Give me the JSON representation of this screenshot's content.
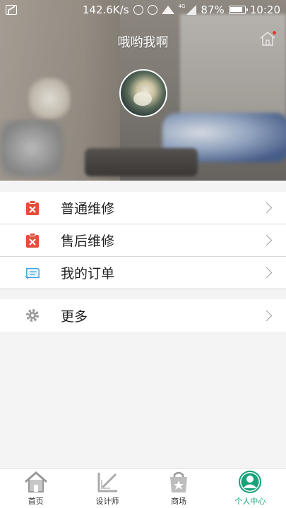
{
  "status_bar": {
    "speed": "142.6K/s",
    "network": "4G",
    "battery": "87%",
    "time": "10:20"
  },
  "header": {
    "title": "哦哟我啊"
  },
  "menu": {
    "items": [
      {
        "label": "普通维修",
        "icon": "repair-clipboard-icon"
      },
      {
        "label": "售后维修",
        "icon": "repair-clipboard-icon"
      },
      {
        "label": "我的订单",
        "icon": "order-scroll-icon"
      }
    ],
    "more": {
      "label": "更多",
      "icon": "gear-icon"
    }
  },
  "tabbar": {
    "tabs": [
      {
        "label": "首页",
        "icon": "home-icon",
        "active": false
      },
      {
        "label": "设计师",
        "icon": "ruler-pencil-icon",
        "active": false
      },
      {
        "label": "商场",
        "icon": "shopping-bag-icon",
        "active": false
      },
      {
        "label": "个人中心",
        "icon": "user-icon",
        "active": true
      }
    ]
  },
  "colors": {
    "accent": "#19a37a",
    "repair_icon_red": "#e74c3c",
    "order_icon_blue": "#3aa6e0",
    "icon_gray": "#9a9a9a"
  }
}
